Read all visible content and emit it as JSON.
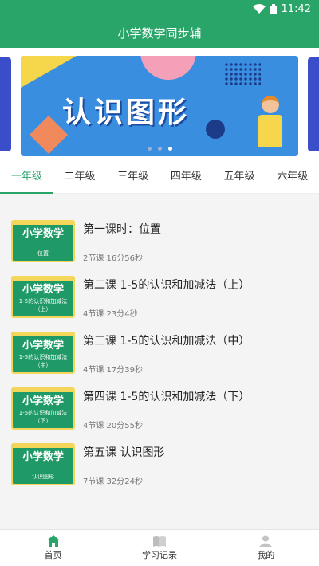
{
  "status": {
    "time": "11:42"
  },
  "app": {
    "title": "小学数学同步辅"
  },
  "banner": {
    "title": "认识图形",
    "dots": 3,
    "active_dot": 2
  },
  "tabs": [
    {
      "label": "一年级",
      "active": true
    },
    {
      "label": "二年级",
      "active": false
    },
    {
      "label": "三年级",
      "active": false
    },
    {
      "label": "四年级",
      "active": false
    },
    {
      "label": "五年级",
      "active": false
    },
    {
      "label": "六年级",
      "active": false
    }
  ],
  "lessons": [
    {
      "title": "第一课时：位置",
      "meta": "2节课 16分56秒",
      "thumb_title": "小学数学",
      "thumb_sub": "位置"
    },
    {
      "title": "第二课 1-5的认识和加减法（上）",
      "meta": "4节课 23分4秒",
      "thumb_title": "小学数学",
      "thumb_sub": "1-5的认识和加减法（上）"
    },
    {
      "title": "第三课 1-5的认识和加减法（中）",
      "meta": "4节课 17分39秒",
      "thumb_title": "小学数学",
      "thumb_sub": "1-5的认识和加减法（中）"
    },
    {
      "title": "第四课 1-5的认识和加减法（下）",
      "meta": "4节课 20分55秒",
      "thumb_title": "小学数学",
      "thumb_sub": "1-5的认识和加减法（下）"
    },
    {
      "title": "第五课 认识图形",
      "meta": "7节课 32分24秒",
      "thumb_title": "小学数学",
      "thumb_sub": "认识图形"
    }
  ],
  "bottom_nav": [
    {
      "label": "首页",
      "icon": "home-icon",
      "active": true
    },
    {
      "label": "学习记录",
      "icon": "book-icon",
      "active": false
    },
    {
      "label": "我的",
      "icon": "user-icon",
      "active": false
    }
  ],
  "colors": {
    "primary": "#2aa56a",
    "banner": "#3a8ee0"
  }
}
